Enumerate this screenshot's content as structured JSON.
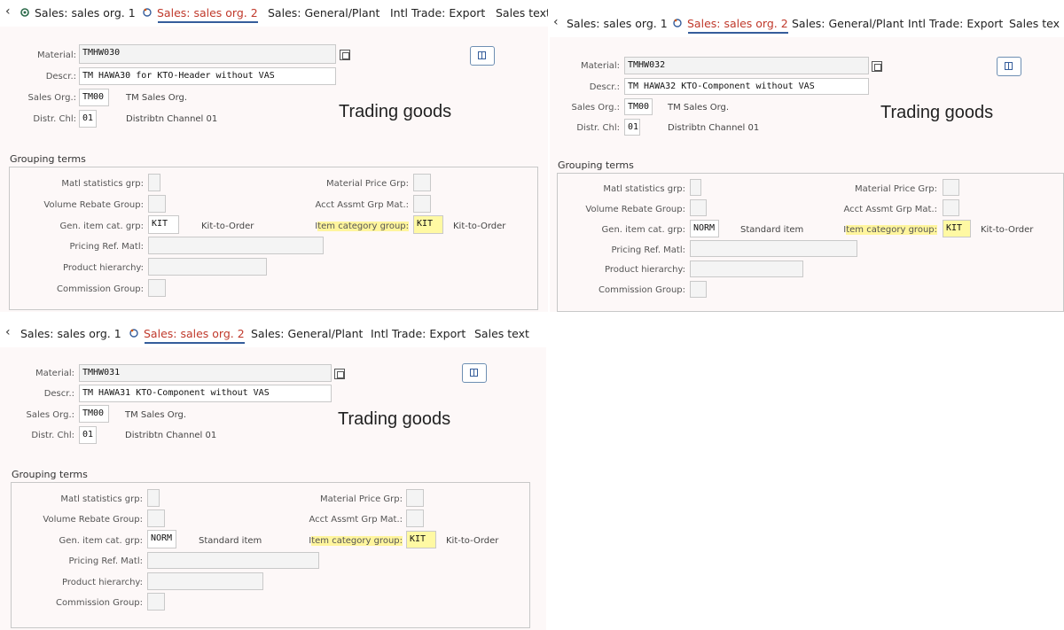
{
  "tabs": [
    "Sales: sales org. 1",
    "Sales: sales org. 2",
    "Sales: General/Plant",
    "Intl Trade: Export",
    "Sales text",
    "Sales tex"
  ],
  "labels": {
    "material": "Material:",
    "descr": "Descr.:",
    "sales_org": "Sales Org.:",
    "distr_chl": "Distr. Chl:",
    "grouping_terms": "Grouping terms",
    "matl_statistics_grp": "Matl statistics grp:",
    "volume_rebate_group": "Volume Rebate Group:",
    "gen_item_cat_grp": "Gen. item cat. grp:",
    "pricing_ref_matl": "Pricing Ref. Matl:",
    "product_hierarchy": "Product hierarchy:",
    "commission_group": "Commission Group:",
    "material_price_grp": "Material Price Grp:",
    "acct_assmt_grp_mat": "Acct Assmt Grp Mat.:",
    "item_category_group_prefix": "I",
    "item_category_group_rest": "tem category group:"
  },
  "screens": [
    {
      "material": "TMHW030",
      "descr": "TM HAWA30 for KTO-Header without VAS",
      "sales_org": "TM00",
      "sales_org_text": "TM Sales Org.",
      "distr_chl": "01",
      "distr_chl_text": "Distribtn Channel 01",
      "note": "Trading goods",
      "gen_item_cat_grp": "KIT",
      "gen_item_cat_text": "Kit-to-Order",
      "item_category_group": "KIT",
      "item_category_text": "Kit-to-Order"
    },
    {
      "material": "TMHW032",
      "descr": "TM HAWA32 KTO-Component without VAS",
      "sales_org": "TM00",
      "sales_org_text": "TM Sales Org.",
      "distr_chl": "01",
      "distr_chl_text": "Distribtn Channel 01",
      "note": "Trading goods",
      "gen_item_cat_grp": "NORM",
      "gen_item_cat_text": "Standard item",
      "item_category_group": "KIT",
      "item_category_text": "Kit-to-Order"
    },
    {
      "material": "TMHW031",
      "descr": "TM HAWA31 KTO-Component without VAS",
      "sales_org": "TM00",
      "sales_org_text": "TM Sales Org.",
      "distr_chl": "01",
      "distr_chl_text": "Distribtn Channel 01",
      "note": "Trading goods",
      "gen_item_cat_grp": "NORM",
      "gen_item_cat_text": "Standard item",
      "item_category_group": "KIT",
      "item_category_text": "Kit-to-Order"
    }
  ],
  "colors": {
    "highlight": "#fff59d",
    "active_tab": "#c0392b",
    "tab_underline": "#355d9b"
  }
}
